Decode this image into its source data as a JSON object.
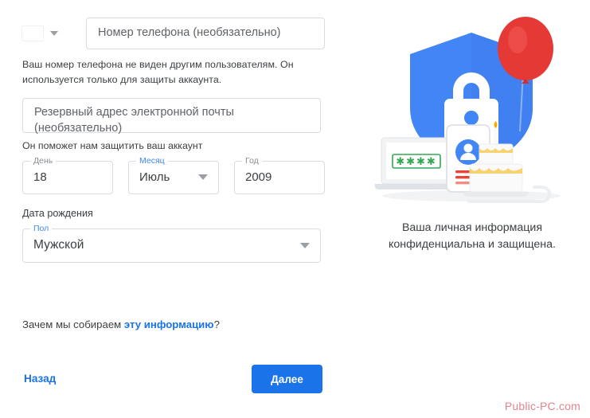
{
  "form": {
    "country": {
      "name": "country-selector",
      "flag_alt": "ukraine-flag",
      "flag_top_color": "#2d6fd0",
      "flag_bottom_color": "#f5d117"
    },
    "phone": {
      "label": "",
      "placeholder": "Номер телефона (необязательно)",
      "value": ""
    },
    "phone_helper": "Ваш номер телефона не виден другим пользователям. Он используется только для защиты аккаунта.",
    "recovery_email": {
      "placeholder": "Резервный адрес электронной почты (необязательно)",
      "value": ""
    },
    "recovery_helper": "Он поможет нам защитить ваш аккаунт",
    "day": {
      "label": "День",
      "value": "18",
      "label_focused": false
    },
    "month": {
      "label": "Месяц",
      "value": "Июль",
      "label_focused": true
    },
    "year": {
      "label": "Год",
      "value": "2009",
      "label_focused": false
    },
    "birthdate_label": "Дата рождения",
    "gender": {
      "label": "Пол",
      "value": "Мужской",
      "label_focused": true
    },
    "why_prefix": "Зачем мы собираем ",
    "why_link": "эту информацию",
    "why_suffix": "?",
    "back_label": "Назад",
    "next_label": "Далее"
  },
  "illustration": {
    "caption_line1": "Ваша личная информация",
    "caption_line2": "конфиденциальна и защищена.",
    "password_mask": "✱✱✱✱",
    "colors": {
      "shield_blue": "#4285f4",
      "shield_blue_dark": "#3b78e7",
      "lock_white": "#ffffff",
      "keyhole_blue": "#4285f4",
      "balloon_red": "#e53935",
      "balloon_red_dark": "#d32f2f",
      "cake_white": "#fafafa",
      "cake_gold": "#f7d270",
      "laptop_gray": "#f1f3f4",
      "password_green": "#34a853",
      "avatar_blue": "#4285f4",
      "line_red": "#ea4335"
    }
  },
  "watermark": {
    "text": "Public-PC.com",
    "color": "#e1848c"
  },
  "theme": {
    "accent_blue": "#1a73e8",
    "border_gray": "#dadce0",
    "text_primary": "#3c4043",
    "text_muted": "#5f6368"
  }
}
